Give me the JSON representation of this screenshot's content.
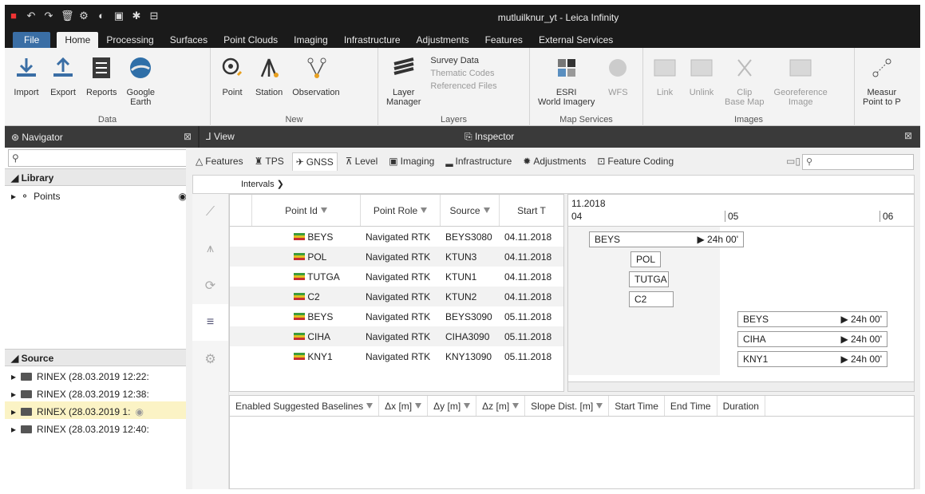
{
  "window": {
    "title": "mutluilknur_yt - Leica Infinity"
  },
  "ribbon_tabs": [
    "File",
    "Home",
    "Processing",
    "Surfaces",
    "Point Clouds",
    "Imaging",
    "Infrastructure",
    "Adjustments",
    "Features",
    "External Services"
  ],
  "ribbon": {
    "data": {
      "label": "Data",
      "buttons": [
        "Import",
        "Export",
        "Reports",
        "Google\nEarth"
      ]
    },
    "new": {
      "label": "New",
      "buttons": [
        "Point",
        "Station",
        "Observation"
      ]
    },
    "layers": {
      "label": "Layers",
      "layer_manager": "Layer\nManager",
      "items": [
        "Survey Data",
        "Thematic Codes",
        "Referenced Files"
      ]
    },
    "map_services": {
      "label": "Map Services",
      "buttons": [
        "ESRI\nWorld Imagery",
        "WFS"
      ]
    },
    "images": {
      "label": "Images",
      "buttons": [
        "Link",
        "Unlink",
        "Clip\nBase Map",
        "Georeference\nImage"
      ]
    },
    "extra": {
      "buttons": [
        "Measur\nPoint to P"
      ]
    }
  },
  "navigator": {
    "title": "Navigator",
    "library_label": "Library",
    "library_items": [
      "Points"
    ],
    "source_label": "Source",
    "source_items": [
      "RINEX (28.03.2019 12:22:",
      "RINEX (28.03.2019 12:38:",
      "RINEX (28.03.2019 1:",
      "RINEX (28.03.2019 12:40:"
    ]
  },
  "view": {
    "title": "View"
  },
  "inspector": {
    "title": "Inspector",
    "tabs": [
      "Features",
      "TPS",
      "GNSS",
      "Level",
      "Imaging",
      "Infrastructure",
      "Adjustments",
      "Feature Coding"
    ],
    "breadcrumb": "Intervals"
  },
  "grid": {
    "headers": [
      "Point Id",
      "Point Role",
      "Source",
      "Start T"
    ],
    "rows": [
      {
        "id": "BEYS",
        "role": "Navigated RTK",
        "source": "BEYS3080",
        "start": "04.11.2018"
      },
      {
        "id": "POL",
        "role": "Navigated RTK",
        "source": "KTUN3",
        "start": "04.11.2018"
      },
      {
        "id": "TUTGA",
        "role": "Navigated RTK",
        "source": "KTUN1",
        "start": "04.11.2018"
      },
      {
        "id": "C2",
        "role": "Navigated RTK",
        "source": "KTUN2",
        "start": "04.11.2018"
      },
      {
        "id": "BEYS",
        "role": "Navigated RTK",
        "source": "BEYS3090",
        "start": "05.11.2018"
      },
      {
        "id": "CIHA",
        "role": "Navigated RTK",
        "source": "CIHA3090",
        "start": "05.11.2018"
      },
      {
        "id": "KNY1",
        "role": "Navigated RTK",
        "source": "KNY13090",
        "start": "05.11.2018"
      }
    ]
  },
  "timeline": {
    "month": "11.2018",
    "days": [
      "04",
      "05",
      "06"
    ],
    "bars": [
      {
        "label": "BEYS",
        "dur": "▶ 24h 00'"
      },
      {
        "label": "POL",
        "dur": ""
      },
      {
        "label": "TUTGA",
        "dur": ""
      },
      {
        "label": "C2",
        "dur": ""
      },
      {
        "label": "BEYS",
        "dur": "▶ 24h 00'"
      },
      {
        "label": "CIHA",
        "dur": "▶ 24h 00'"
      },
      {
        "label": "KNY1",
        "dur": "▶ 24h 00'"
      }
    ]
  },
  "baselines": {
    "headers": [
      "Enabled Suggested Baselines",
      "Δx [m]",
      "Δy [m]",
      "Δz [m]",
      "Slope Dist. [m]",
      "Start Time",
      "End Time",
      "Duration"
    ]
  }
}
